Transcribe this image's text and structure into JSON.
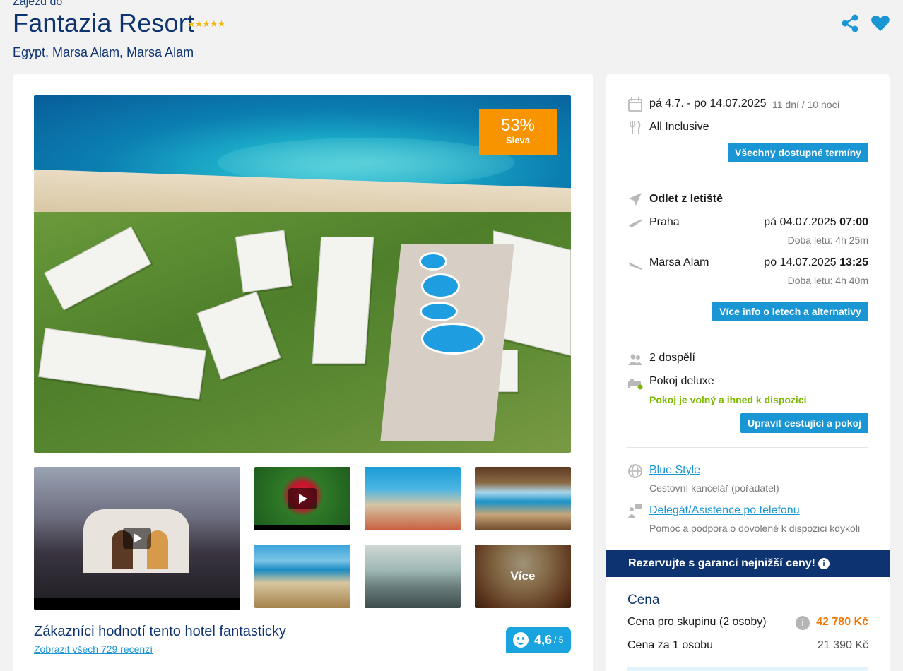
{
  "header": {
    "breadcrumb": "Zájezd do",
    "title": "Fantazia Resort",
    "stars": "★★★★★",
    "location": "Egypt, Marsa Alam, Marsa Alam"
  },
  "icons": {
    "share": "share-icon",
    "favorite": "heart-icon",
    "calendar": "calendar-icon",
    "board": "fork-knife-icon",
    "departure": "plane-icon",
    "takeoff": "plane-takeoff-icon",
    "landing": "plane-landing-icon",
    "travelers": "people-icon",
    "room": "bed-icon",
    "agency": "globe-icon",
    "support": "chat-person-icon",
    "info": "info-icon",
    "rating": "smiley-icon"
  },
  "gallery": {
    "discount_pct": "53%",
    "discount_label": "Sleva",
    "more_label": "Více"
  },
  "reviews": {
    "title": "Zákazníci hodnotí tento hotel fantasticky",
    "link": "Zobrazit všech 729 recenzí",
    "score": "4,6",
    "scale": "/ 5"
  },
  "trip": {
    "dates": "pá 4.7. - po 14.07.2025",
    "duration": "11 dní / 10 nocí",
    "board": "All Inclusive",
    "terms_button": "Všechny dostupné termíny"
  },
  "flights": {
    "heading": "Odlet z letiště",
    "outbound": {
      "city": "Praha",
      "date": "pá 04.07.2025",
      "time": "07:00",
      "duration": "Doba letu: 4h 25m"
    },
    "inbound": {
      "city": "Marsa Alam",
      "date": "po 14.07.2025",
      "time": "13:25",
      "duration": "Doba letu: 4h 40m"
    },
    "more_button": "Více info o letech a alternativy"
  },
  "room": {
    "travelers": "2 dospělí",
    "room_type": "Pokoj deluxe",
    "availability": "Pokoj je volný a ihned k dispozici",
    "edit_button": "Upravit cestující a pokoj"
  },
  "agency": {
    "name": "Blue Style",
    "role": "Cestovní kancelář (pořadatel)",
    "support_link": "Delegát/Asistence po telefonu",
    "support_text": "Pomoc a podpora o dovolené k dispozici kdykoli"
  },
  "pricing": {
    "banner": "Rezervujte s garancí nejnižší ceny!",
    "heading": "Cena",
    "group_label": "Cena pro skupinu (2 osoby)",
    "group_price": "42 780 Kč",
    "person_label": "Cena za 1 osobu",
    "person_price": "21 390 Kč"
  },
  "colors": {
    "brand_navy": "#0d3471",
    "accent_blue": "#1a96d4",
    "sale_orange": "#f79400",
    "price_orange": "#f07800",
    "available_green": "#7bb800"
  }
}
